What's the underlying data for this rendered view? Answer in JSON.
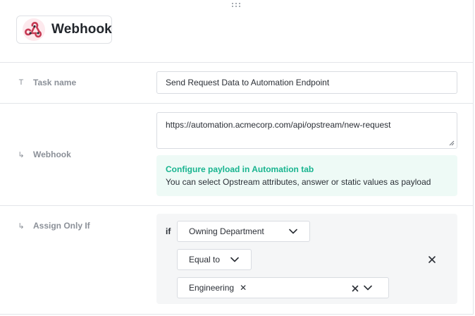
{
  "header": {
    "title": "Webhook",
    "icon": "webhook-icon",
    "icon_color": "#c73b55"
  },
  "task_name": {
    "label": "Task name",
    "glyph": "T",
    "value": "Send Request Data to Automation Endpoint"
  },
  "webhook": {
    "label": "Webhook",
    "glyph": "↳",
    "url": "https://automation.acmecorp.com/api/opstream/new-request",
    "info_title": "Configure payload in Automation tab",
    "info_text": "You can select Opstream attributes, answer or static values as payload",
    "info_title_color": "#17b48f",
    "info_bg_color": "#eefaf6"
  },
  "assign_only_if": {
    "label": "Assign Only If",
    "glyph": "↳",
    "if_label": "if",
    "field": "Owning Department",
    "operator": "Equal to",
    "value_tag": "Engineering"
  }
}
